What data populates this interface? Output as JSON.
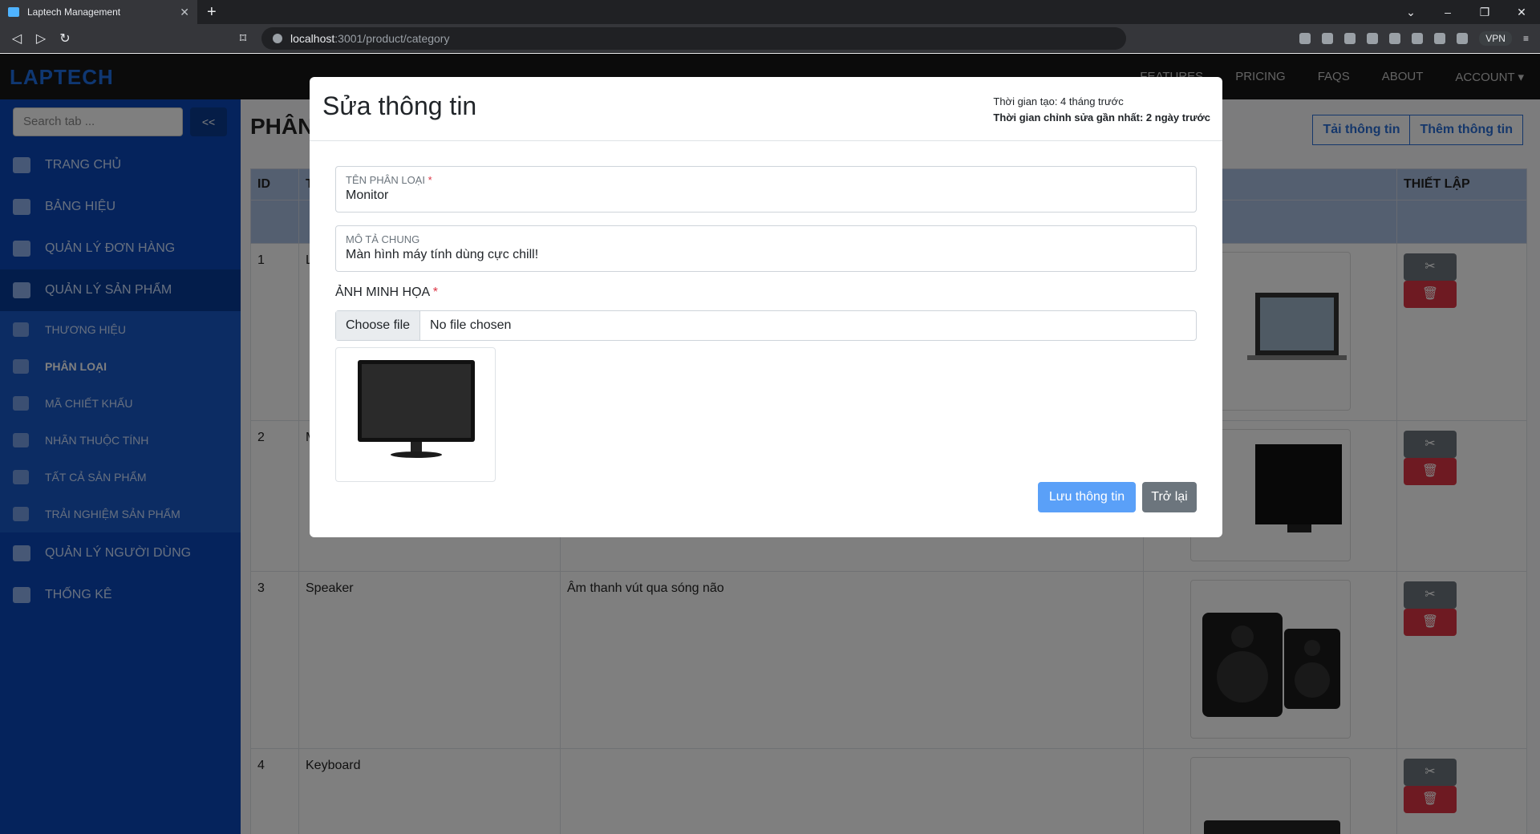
{
  "browser": {
    "tab_title": "Laptech Management",
    "url_host": "localhost",
    "url_rest": ":3001/product/category",
    "vpn_label": "VPN"
  },
  "app": {
    "logo": "LAPTECH",
    "topmenu": [
      "FEATURES",
      "PRICING",
      "FAQS",
      "ABOUT",
      "ACCOUNT ▾"
    ]
  },
  "sidebar": {
    "search_placeholder": "Search tab ...",
    "collapse_label": "<<",
    "items": [
      {
        "label": "TRANG CHỦ",
        "icon": "home-icon"
      },
      {
        "label": "BẢNG HIỆU",
        "icon": "ad-icon"
      },
      {
        "label": "QUẢN LÝ ĐƠN HÀNG",
        "icon": "table-icon"
      },
      {
        "label": "QUẢN LÝ SẢN PHẨM",
        "icon": "grid-icon"
      }
    ],
    "subitems": [
      {
        "label": "THƯƠNG HIỆU",
        "icon": "globe-icon"
      },
      {
        "label": "PHÂN LOẠI",
        "icon": "list-icon"
      },
      {
        "label": "MÃ CHIẾT KHẤU",
        "icon": "percent-icon"
      },
      {
        "label": "NHÃN THUỘC TÍNH",
        "icon": "tag-icon"
      },
      {
        "label": "TẤT CẢ SẢN PHẨM",
        "icon": "laptop-icon"
      },
      {
        "label": "TRẢI NGHIỆM SẢN PHẨM",
        "icon": "card-list-icon"
      }
    ],
    "bottom_items": [
      {
        "label": "QUẢN LÝ NGƯỜI DÙNG",
        "icon": "user-icon"
      },
      {
        "label": "THỐNG KÊ",
        "icon": "bar-chart-icon"
      }
    ]
  },
  "main": {
    "title": "PHÂN",
    "load_button": "Tải thông tin",
    "add_button": "Thêm thông tin",
    "columns": [
      "ID",
      "T",
      "",
      "HỌA",
      "THIẾT LẬP"
    ],
    "rows": [
      {
        "id": "1",
        "name": "L",
        "desc": ""
      },
      {
        "id": "2",
        "name": "M",
        "desc": ""
      },
      {
        "id": "3",
        "name": "Speaker",
        "desc": "Âm thanh vút qua sóng não"
      },
      {
        "id": "4",
        "name": "Keyboard",
        "desc": ""
      }
    ]
  },
  "modal": {
    "title": "Sửa thông tin",
    "created": "Thời gian tạo: 4 tháng trước",
    "modified": "Thời gian chỉnh sửa gần nhất: 2 ngày trước",
    "name_label": "TÊN PHÂN LOẠI",
    "name_value": "Monitor",
    "desc_label": "MÔ TẢ CHUNG",
    "desc_value": "Màn hình máy tính dùng cực chill!",
    "image_label": "ẢNH MINH HỌA",
    "file_button": "Choose file",
    "file_status": "No file chosen",
    "save_button": "Lưu thông tin",
    "back_button": "Trở lại"
  }
}
